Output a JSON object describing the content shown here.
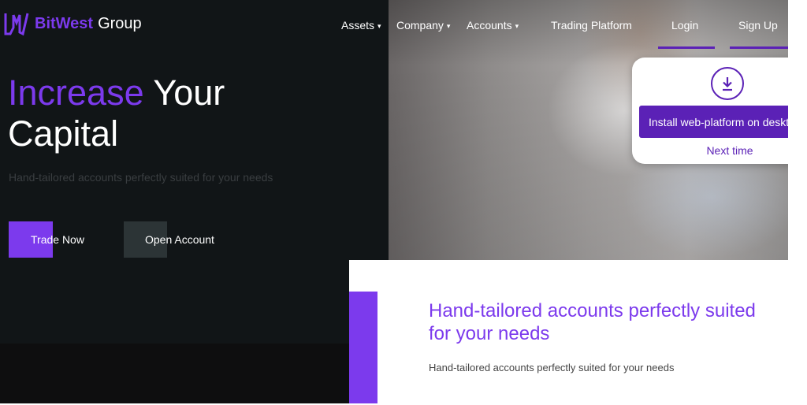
{
  "logo": {
    "brand": "BitWest",
    "group": "Group",
    "icon": "bw-logo-icon"
  },
  "nav": {
    "items": [
      {
        "label": "Assets",
        "dropdown": true
      },
      {
        "label": "Company",
        "dropdown": true
      },
      {
        "label": "Accounts",
        "dropdown": true
      },
      {
        "label": "Trading Platform",
        "dropdown": false
      }
    ],
    "login": "Login",
    "signup": "Sign Up"
  },
  "hero": {
    "title_accent": "Increase",
    "title_rest": "Your",
    "title_line2": "Capital",
    "subtitle": "Hand-tailored accounts perfectly suited for your needs",
    "trade_button": "Trade Now",
    "open_button": "Open Account"
  },
  "popup": {
    "icon": "download-icon",
    "install_button": "Install web-platform on desktop",
    "next_time": "Next time"
  },
  "section": {
    "title_line1": "Hand-tailored accounts perfectly suited",
    "title_line2": "for your needs",
    "text": "Hand-tailored accounts perfectly suited for your needs"
  },
  "colors": {
    "accent": "#7c3aed",
    "accent_dark": "#5b21b6",
    "background_dark": "#111517",
    "secondary_button": "#2c3436"
  }
}
